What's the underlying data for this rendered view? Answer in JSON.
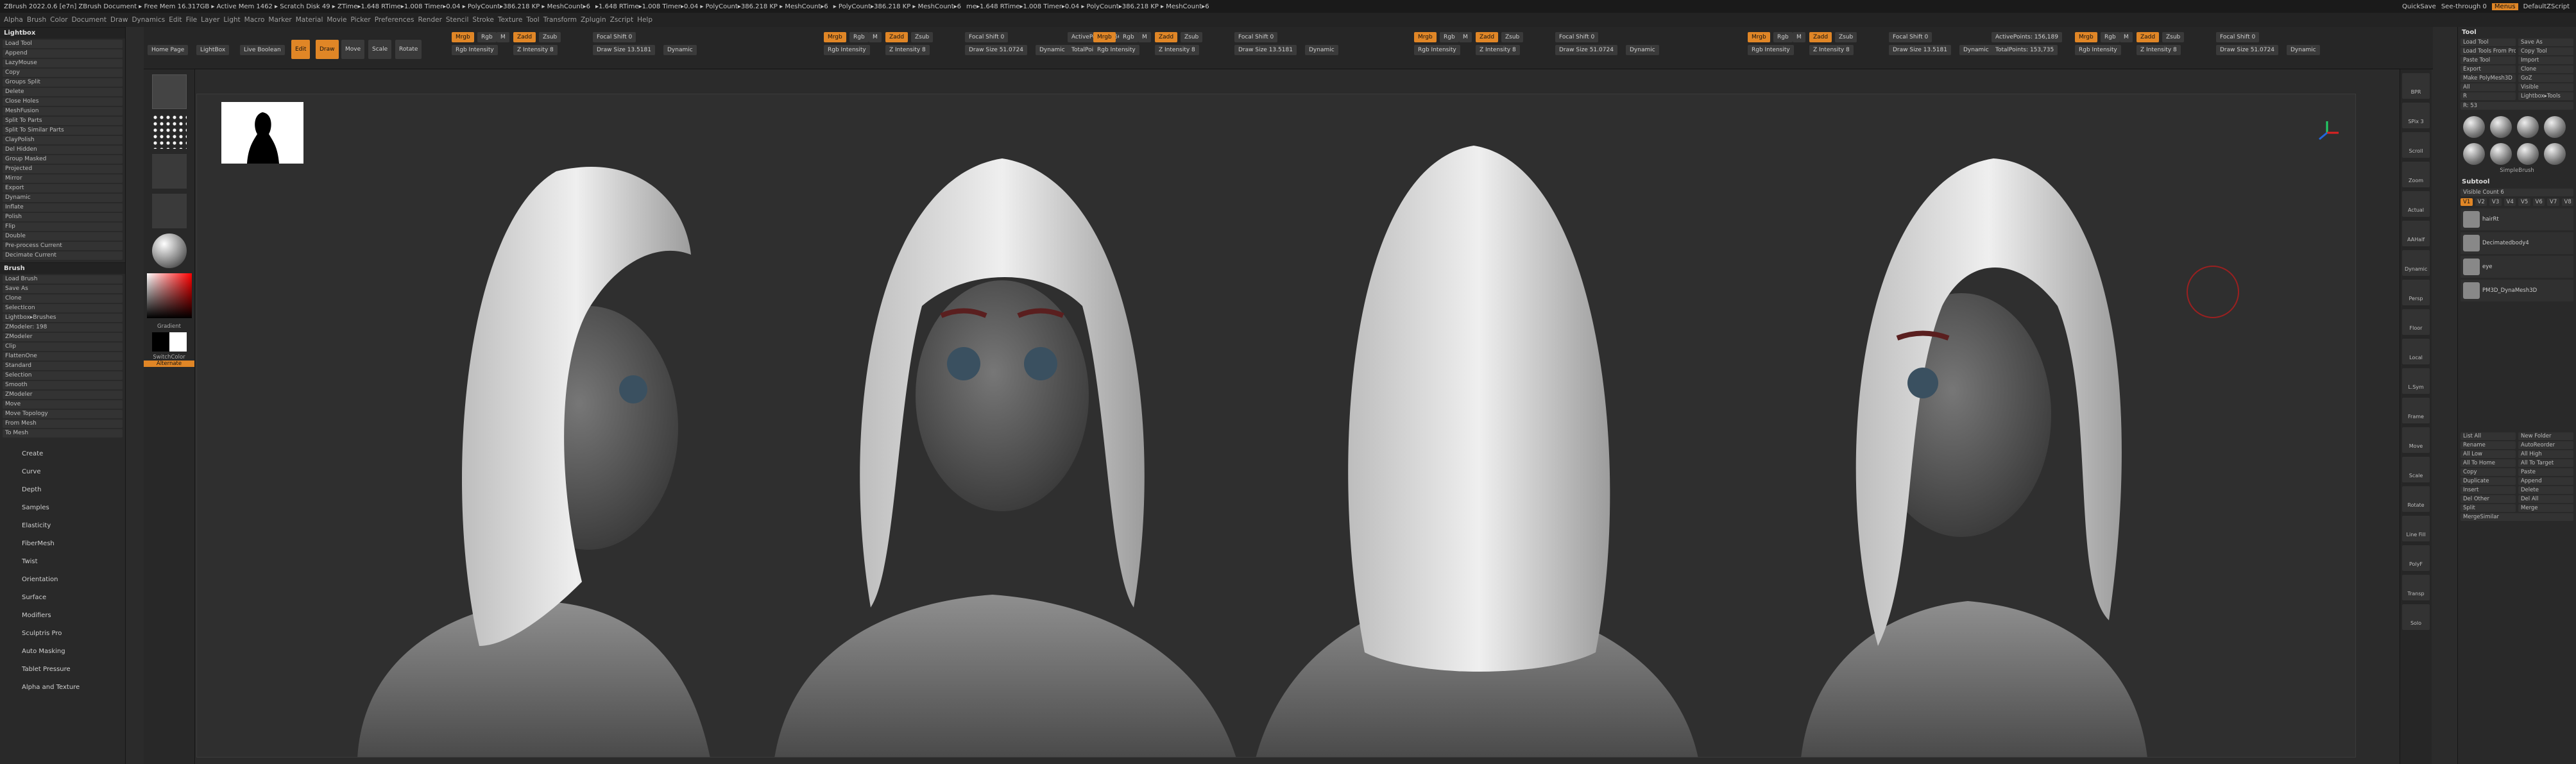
{
  "titlebar": {
    "left_text": "ZBrush 2022.0.6 [e7n] ZBrush Document  ▸ Free Mem 16.317GB ▸ Active Mem 1462 ▸ Scratch Disk 49 ▸ ZTime▸1.648 RTime▸1.008 Timer▸0.04 ▸ PolyCount▸386.218 KP ▸ MeshCount▸6",
    "mid_text": "▸1.648 RTime▸1.008 Timer▸0.04 ▸ PolyCount▸386.218 KP ▸ MeshCount▸6",
    "mid2_text": "▸ PolyCount▸386.218 KP ▸ MeshCount▸6",
    "right_text": "me▸1.648 RTime▸1.008 Timer▸0.04 ▸ PolyCount▸386.218 KP ▸ MeshCount▸6",
    "quicksave": "QuickSave",
    "seethrough": "See-through 0",
    "menus_label": "Menus",
    "script_label": "DefaultZScript"
  },
  "menubar": [
    "Alpha",
    "Brush",
    "Color",
    "Document",
    "Draw",
    "Dynamics",
    "Edit",
    "File",
    "Layer",
    "Light",
    "Macro",
    "Marker",
    "Material",
    "Movie",
    "Picker",
    "Preferences",
    "Render",
    "Stencil",
    "Stroke",
    "Texture",
    "Tool",
    "Transform",
    "Zplugin",
    "Zscript",
    "Help"
  ],
  "left_panel": {
    "title": "Lightbox",
    "items": [
      "Load Tool",
      "Append",
      "LazyMouse",
      "Copy",
      "Groups Split",
      "Delete",
      "Close Holes",
      "MeshFusion",
      "Split To Parts",
      "Split To Similar Parts",
      "ClayPolish",
      "Del Hidden",
      "Group Masked",
      "Projected",
      "Mirror",
      "Export",
      "Dynamic",
      "Inflate",
      "Polish",
      "Flip",
      "Double",
      "Pre-process Current",
      "Decimate Current"
    ],
    "brush_head": "Brush",
    "brush_items": [
      "Load Brush",
      "Save As",
      "Clone",
      "SelectIcon",
      "Lightbox▸Brushes",
      "ZModeler: 198",
      "ZModeler",
      "Clip",
      "FlattenOne",
      "Standard",
      "Selection",
      "Smooth",
      "ZModeler",
      "Move",
      "Move Topology",
      "From Mesh",
      "To Mesh"
    ],
    "sub_menu": [
      "Create",
      "Curve",
      "Depth",
      "Samples",
      "Elasticity",
      "FiberMesh",
      "Twist",
      "Orientation",
      "Surface",
      "Modifiers",
      "Sculptris Pro",
      "Auto Masking",
      "Tablet Pressure",
      "Alpha and Texture"
    ],
    "color_labels": [
      "Gradient",
      "SwitchColor",
      "Alternate"
    ]
  },
  "shelf": {
    "buttons": [
      "Home Page",
      "LightBox",
      "Live Boolean",
      "Edit",
      "Draw",
      "Move",
      "Scale",
      "Rotate"
    ],
    "groups": [
      {
        "mrgb": "Mrgb",
        "rgb": "Rgb",
        "m": "M",
        "zadd": "Zadd",
        "zsub": "Zsub",
        "zcut": "Zcut",
        "focal": "Focal Shift 0",
        "drawsize": "Draw Size 13.5181",
        "dynamic": "Dynamic",
        "active_points": "ActivePoints: 156,189",
        "total_points": "TotalPoints: 153,735",
        "rgb_intensity": "Rgb Intensity",
        "z_intensity": "Z Intensity 8"
      },
      {
        "mrgb": "Mrgb",
        "rgb": "Rgb",
        "m": "M",
        "zadd": "Zadd",
        "zsub": "Zsub",
        "zcut": "Zcut",
        "focal": "Focal Shift 0",
        "drawsize": "Draw Size 51.0724",
        "dynamic": "Dynamic",
        "active_points": "ActivePoints: 156,189",
        "total_points": "TotalPoints: 153,735",
        "rgb_intensity": "Rgb Intensity",
        "z_intensity": "Z Intensity 8"
      }
    ]
  },
  "viewport": {
    "thumb_label": "silhouette",
    "panes": [
      "left-three-quarter",
      "front",
      "back",
      "right-three-quarter"
    ]
  },
  "right_panel": {
    "title": "Tool",
    "top_buttons": [
      "Load Tool",
      "Save As",
      "Load Tools From Project",
      "Copy Tool",
      "Paste Tool",
      "Import",
      "Export",
      "Clone",
      "Make PolyMesh3D",
      "GoZ",
      "All",
      "Visible",
      "R",
      "Lightbox▸Tools"
    ],
    "r_value": "R: 53",
    "tool_label": "SimpleBrush",
    "subtool_head": "Subtool",
    "visible_count": "Visible Count 6",
    "subtools": [
      "hairRt",
      "Decimatedbody4",
      "eye",
      "PM3D_DynaMesh3D"
    ],
    "tabs": [
      "V1",
      "V2",
      "V3",
      "V4",
      "V5",
      "V6",
      "V7",
      "V8"
    ],
    "lower_buttons": [
      "List All",
      "New Folder",
      "Rename",
      "AutoReorder",
      "All Low",
      "All High",
      "All To Home",
      "All To Target",
      "Copy",
      "Paste",
      "Duplicate",
      "Append",
      "Insert",
      "Delete",
      "Del Other",
      "Del All",
      "Split",
      "Merge",
      "MergeSimilar"
    ]
  },
  "vtool": [
    "BPR",
    "SPix 3",
    "Scroll",
    "Zoom",
    "Actual",
    "AAHalf",
    "Dynamic",
    "Persp",
    "Floor",
    "Local",
    "L.Sym",
    "Frame",
    "Move",
    "Scale",
    "Rotate",
    "Line Fill",
    "PolyF",
    "Transp",
    "Solo"
  ],
  "colors": {
    "orange": "#e08626",
    "bg": "#2f2f2f",
    "panel": "#292929"
  }
}
